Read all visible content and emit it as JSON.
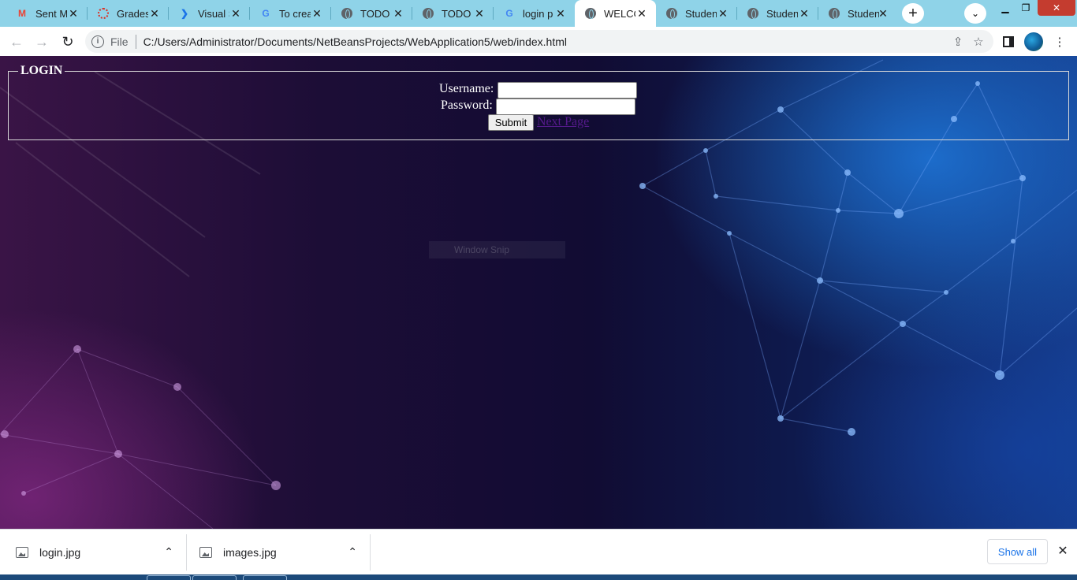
{
  "browser": {
    "tabs": [
      {
        "title": "Sent M",
        "icon": "gmail-icon",
        "color": "#ea4335"
      },
      {
        "title": "Grades",
        "icon": "grades-spinner-icon",
        "color": "#d93025"
      },
      {
        "title": "Visual S",
        "icon": "vscode-icon",
        "color": "#1a73e8"
      },
      {
        "title": "To crea",
        "icon": "google-icon",
        "color": "#4285f4"
      },
      {
        "title": "TODO s",
        "icon": "globe-icon",
        "color": "#5f6368"
      },
      {
        "title": "TODO s",
        "icon": "globe-icon",
        "color": "#5f6368"
      },
      {
        "title": "login p",
        "icon": "google-icon",
        "color": "#4285f4"
      },
      {
        "title": "WELCC",
        "icon": "globe-icon",
        "color": "#5f6368",
        "active": true
      },
      {
        "title": "Studen",
        "icon": "globe-icon",
        "color": "#5f6368"
      },
      {
        "title": "Studen",
        "icon": "globe-icon",
        "color": "#5f6368"
      },
      {
        "title": "Studen",
        "icon": "globe-icon",
        "color": "#5f6368"
      }
    ],
    "file_label": "File",
    "url": "C:/Users/Administrator/Documents/NetBeansProjects/WebApplication5/web/index.html"
  },
  "page": {
    "legend": "LOGIN",
    "username_label": "Username:",
    "password_label": "Password:",
    "username_value": "",
    "password_value": "",
    "submit_label": "Submit",
    "next_link": "Next Page",
    "snip_overlay": "Window Snip"
  },
  "downloads": {
    "items": [
      {
        "name": "login.jpg"
      },
      {
        "name": "images.jpg"
      }
    ],
    "show_all": "Show all"
  },
  "colors": {
    "tabstrip": "#8fd3e8",
    "link_visited": "#551a8b",
    "show_all": "#1a73e8"
  }
}
